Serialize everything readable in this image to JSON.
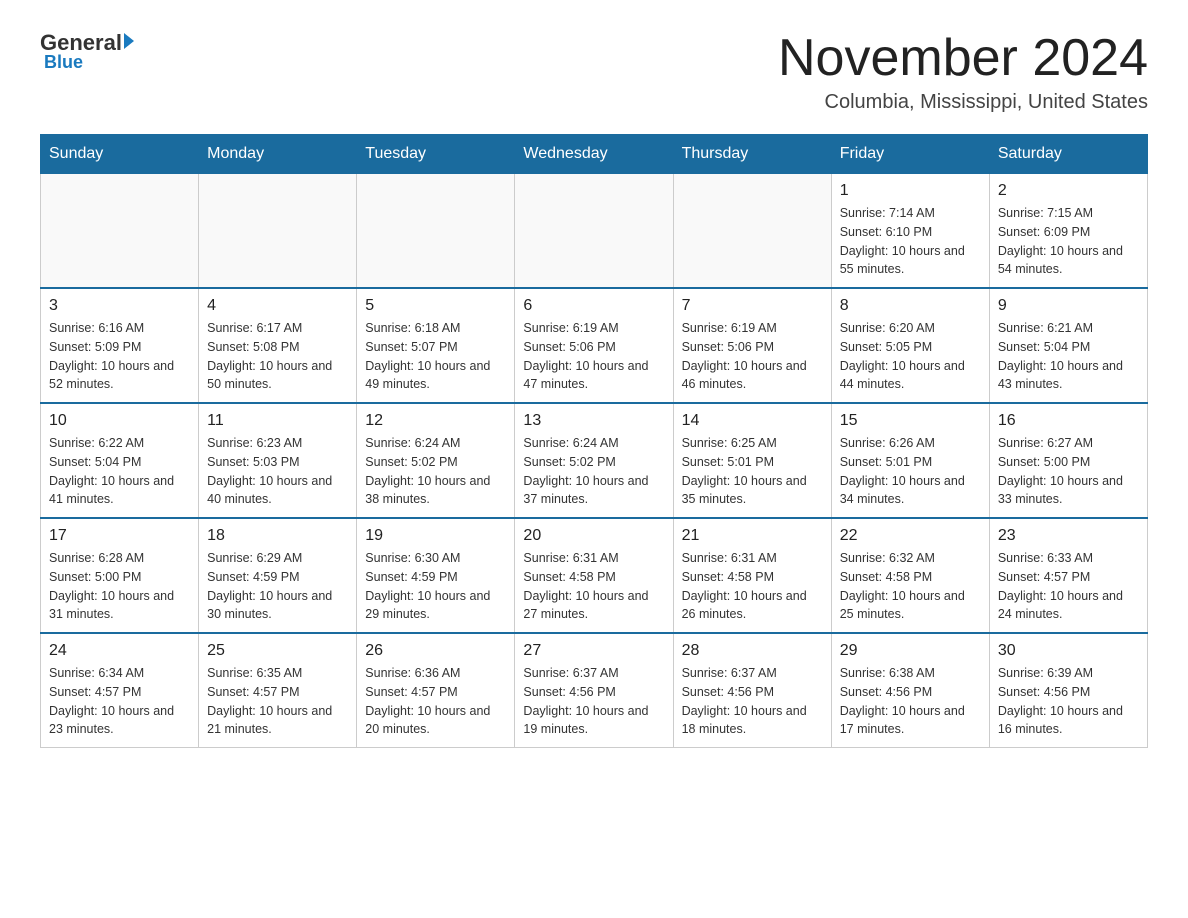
{
  "header": {
    "logo_general": "General",
    "logo_blue": "Blue",
    "month_title": "November 2024",
    "location": "Columbia, Mississippi, United States"
  },
  "weekdays": [
    "Sunday",
    "Monday",
    "Tuesday",
    "Wednesday",
    "Thursday",
    "Friday",
    "Saturday"
  ],
  "weeks": [
    [
      {
        "day": "",
        "sunrise": "",
        "sunset": "",
        "daylight": ""
      },
      {
        "day": "",
        "sunrise": "",
        "sunset": "",
        "daylight": ""
      },
      {
        "day": "",
        "sunrise": "",
        "sunset": "",
        "daylight": ""
      },
      {
        "day": "",
        "sunrise": "",
        "sunset": "",
        "daylight": ""
      },
      {
        "day": "",
        "sunrise": "",
        "sunset": "",
        "daylight": ""
      },
      {
        "day": "1",
        "sunrise": "Sunrise: 7:14 AM",
        "sunset": "Sunset: 6:10 PM",
        "daylight": "Daylight: 10 hours and 55 minutes."
      },
      {
        "day": "2",
        "sunrise": "Sunrise: 7:15 AM",
        "sunset": "Sunset: 6:09 PM",
        "daylight": "Daylight: 10 hours and 54 minutes."
      }
    ],
    [
      {
        "day": "3",
        "sunrise": "Sunrise: 6:16 AM",
        "sunset": "Sunset: 5:09 PM",
        "daylight": "Daylight: 10 hours and 52 minutes."
      },
      {
        "day": "4",
        "sunrise": "Sunrise: 6:17 AM",
        "sunset": "Sunset: 5:08 PM",
        "daylight": "Daylight: 10 hours and 50 minutes."
      },
      {
        "day": "5",
        "sunrise": "Sunrise: 6:18 AM",
        "sunset": "Sunset: 5:07 PM",
        "daylight": "Daylight: 10 hours and 49 minutes."
      },
      {
        "day": "6",
        "sunrise": "Sunrise: 6:19 AM",
        "sunset": "Sunset: 5:06 PM",
        "daylight": "Daylight: 10 hours and 47 minutes."
      },
      {
        "day": "7",
        "sunrise": "Sunrise: 6:19 AM",
        "sunset": "Sunset: 5:06 PM",
        "daylight": "Daylight: 10 hours and 46 minutes."
      },
      {
        "day": "8",
        "sunrise": "Sunrise: 6:20 AM",
        "sunset": "Sunset: 5:05 PM",
        "daylight": "Daylight: 10 hours and 44 minutes."
      },
      {
        "day": "9",
        "sunrise": "Sunrise: 6:21 AM",
        "sunset": "Sunset: 5:04 PM",
        "daylight": "Daylight: 10 hours and 43 minutes."
      }
    ],
    [
      {
        "day": "10",
        "sunrise": "Sunrise: 6:22 AM",
        "sunset": "Sunset: 5:04 PM",
        "daylight": "Daylight: 10 hours and 41 minutes."
      },
      {
        "day": "11",
        "sunrise": "Sunrise: 6:23 AM",
        "sunset": "Sunset: 5:03 PM",
        "daylight": "Daylight: 10 hours and 40 minutes."
      },
      {
        "day": "12",
        "sunrise": "Sunrise: 6:24 AM",
        "sunset": "Sunset: 5:02 PM",
        "daylight": "Daylight: 10 hours and 38 minutes."
      },
      {
        "day": "13",
        "sunrise": "Sunrise: 6:24 AM",
        "sunset": "Sunset: 5:02 PM",
        "daylight": "Daylight: 10 hours and 37 minutes."
      },
      {
        "day": "14",
        "sunrise": "Sunrise: 6:25 AM",
        "sunset": "Sunset: 5:01 PM",
        "daylight": "Daylight: 10 hours and 35 minutes."
      },
      {
        "day": "15",
        "sunrise": "Sunrise: 6:26 AM",
        "sunset": "Sunset: 5:01 PM",
        "daylight": "Daylight: 10 hours and 34 minutes."
      },
      {
        "day": "16",
        "sunrise": "Sunrise: 6:27 AM",
        "sunset": "Sunset: 5:00 PM",
        "daylight": "Daylight: 10 hours and 33 minutes."
      }
    ],
    [
      {
        "day": "17",
        "sunrise": "Sunrise: 6:28 AM",
        "sunset": "Sunset: 5:00 PM",
        "daylight": "Daylight: 10 hours and 31 minutes."
      },
      {
        "day": "18",
        "sunrise": "Sunrise: 6:29 AM",
        "sunset": "Sunset: 4:59 PM",
        "daylight": "Daylight: 10 hours and 30 minutes."
      },
      {
        "day": "19",
        "sunrise": "Sunrise: 6:30 AM",
        "sunset": "Sunset: 4:59 PM",
        "daylight": "Daylight: 10 hours and 29 minutes."
      },
      {
        "day": "20",
        "sunrise": "Sunrise: 6:31 AM",
        "sunset": "Sunset: 4:58 PM",
        "daylight": "Daylight: 10 hours and 27 minutes."
      },
      {
        "day": "21",
        "sunrise": "Sunrise: 6:31 AM",
        "sunset": "Sunset: 4:58 PM",
        "daylight": "Daylight: 10 hours and 26 minutes."
      },
      {
        "day": "22",
        "sunrise": "Sunrise: 6:32 AM",
        "sunset": "Sunset: 4:58 PM",
        "daylight": "Daylight: 10 hours and 25 minutes."
      },
      {
        "day": "23",
        "sunrise": "Sunrise: 6:33 AM",
        "sunset": "Sunset: 4:57 PM",
        "daylight": "Daylight: 10 hours and 24 minutes."
      }
    ],
    [
      {
        "day": "24",
        "sunrise": "Sunrise: 6:34 AM",
        "sunset": "Sunset: 4:57 PM",
        "daylight": "Daylight: 10 hours and 23 minutes."
      },
      {
        "day": "25",
        "sunrise": "Sunrise: 6:35 AM",
        "sunset": "Sunset: 4:57 PM",
        "daylight": "Daylight: 10 hours and 21 minutes."
      },
      {
        "day": "26",
        "sunrise": "Sunrise: 6:36 AM",
        "sunset": "Sunset: 4:57 PM",
        "daylight": "Daylight: 10 hours and 20 minutes."
      },
      {
        "day": "27",
        "sunrise": "Sunrise: 6:37 AM",
        "sunset": "Sunset: 4:56 PM",
        "daylight": "Daylight: 10 hours and 19 minutes."
      },
      {
        "day": "28",
        "sunrise": "Sunrise: 6:37 AM",
        "sunset": "Sunset: 4:56 PM",
        "daylight": "Daylight: 10 hours and 18 minutes."
      },
      {
        "day": "29",
        "sunrise": "Sunrise: 6:38 AM",
        "sunset": "Sunset: 4:56 PM",
        "daylight": "Daylight: 10 hours and 17 minutes."
      },
      {
        "day": "30",
        "sunrise": "Sunrise: 6:39 AM",
        "sunset": "Sunset: 4:56 PM",
        "daylight": "Daylight: 10 hours and 16 minutes."
      }
    ]
  ]
}
